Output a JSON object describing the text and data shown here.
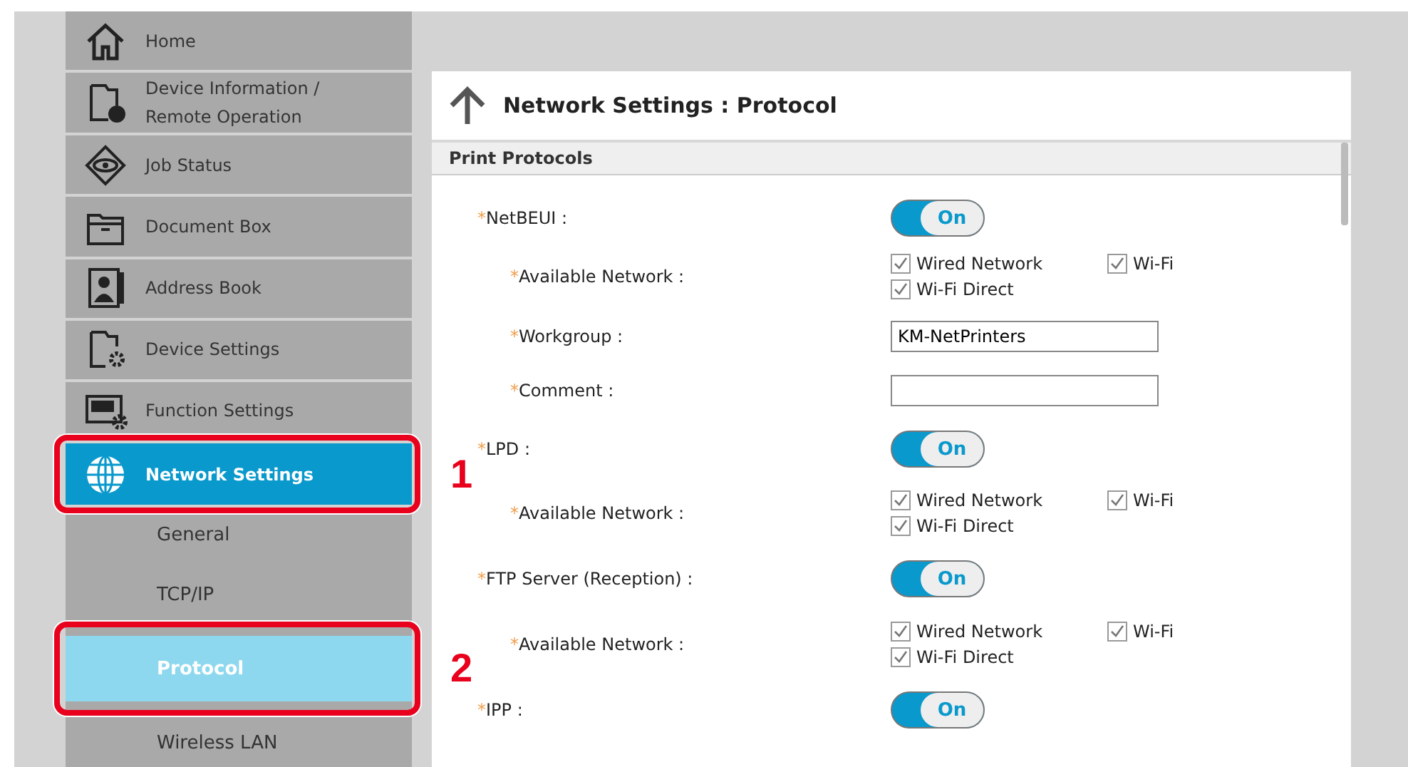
{
  "sidebar": {
    "items": [
      {
        "label": "Home",
        "selected": false
      },
      {
        "label": "Device Information /\nRemote Operation",
        "selected": false
      },
      {
        "label": "Job Status",
        "selected": false
      },
      {
        "label": "Document Box",
        "selected": false
      },
      {
        "label": "Address Book",
        "selected": false
      },
      {
        "label": "Device Settings",
        "selected": false
      },
      {
        "label": "Function Settings",
        "selected": false
      },
      {
        "label": "Network Settings",
        "selected": true,
        "callout": "1",
        "children": [
          {
            "label": "General",
            "selected": false
          },
          {
            "label": "TCP/IP",
            "selected": false
          },
          {
            "label": "Protocol",
            "selected": true,
            "callout": "2"
          },
          {
            "label": "Wireless LAN",
            "selected": false
          }
        ]
      }
    ]
  },
  "page": {
    "title": "Network Settings : Protocol",
    "section": "Print Protocols",
    "rows": [
      {
        "kind": "toggle",
        "label": "NetBEUI :",
        "required_mark": "*",
        "on": true,
        "value": "On"
      },
      {
        "kind": "checks",
        "label": "Available Network :",
        "required_mark": "*",
        "options": [
          {
            "label": "Wired Network",
            "checked": true
          },
          {
            "label": "Wi-Fi",
            "checked": true
          },
          {
            "label": "Wi-Fi Direct",
            "checked": true
          }
        ]
      },
      {
        "kind": "text",
        "label": "Workgroup :",
        "required_mark": "*",
        "value": "KM-NetPrinters"
      },
      {
        "kind": "text",
        "label": "Comment :",
        "required_mark": "*"
      },
      {
        "kind": "toggle",
        "label": "LPD :",
        "required_mark": "*",
        "on": true,
        "value": "On"
      },
      {
        "kind": "checks",
        "label": "Available Network :",
        "required_mark": "*",
        "options": [
          {
            "label": "Wired Network",
            "checked": true
          },
          {
            "label": "Wi-Fi",
            "checked": true
          },
          {
            "label": "Wi-Fi Direct",
            "checked": true
          }
        ]
      },
      {
        "kind": "toggle",
        "label": "FTP Server (Reception) :",
        "required_mark": "*",
        "on": true,
        "value": "On"
      },
      {
        "kind": "checks",
        "label": "Available Network :",
        "required_mark": "*",
        "options": [
          {
            "label": "Wired Network",
            "checked": true
          },
          {
            "label": "Wi-Fi",
            "checked": true
          },
          {
            "label": "Wi-Fi Direct",
            "checked": true
          }
        ]
      },
      {
        "kind": "toggle",
        "label": "IPP :",
        "required_mark": "*",
        "on": true,
        "value": "On"
      }
    ]
  }
}
